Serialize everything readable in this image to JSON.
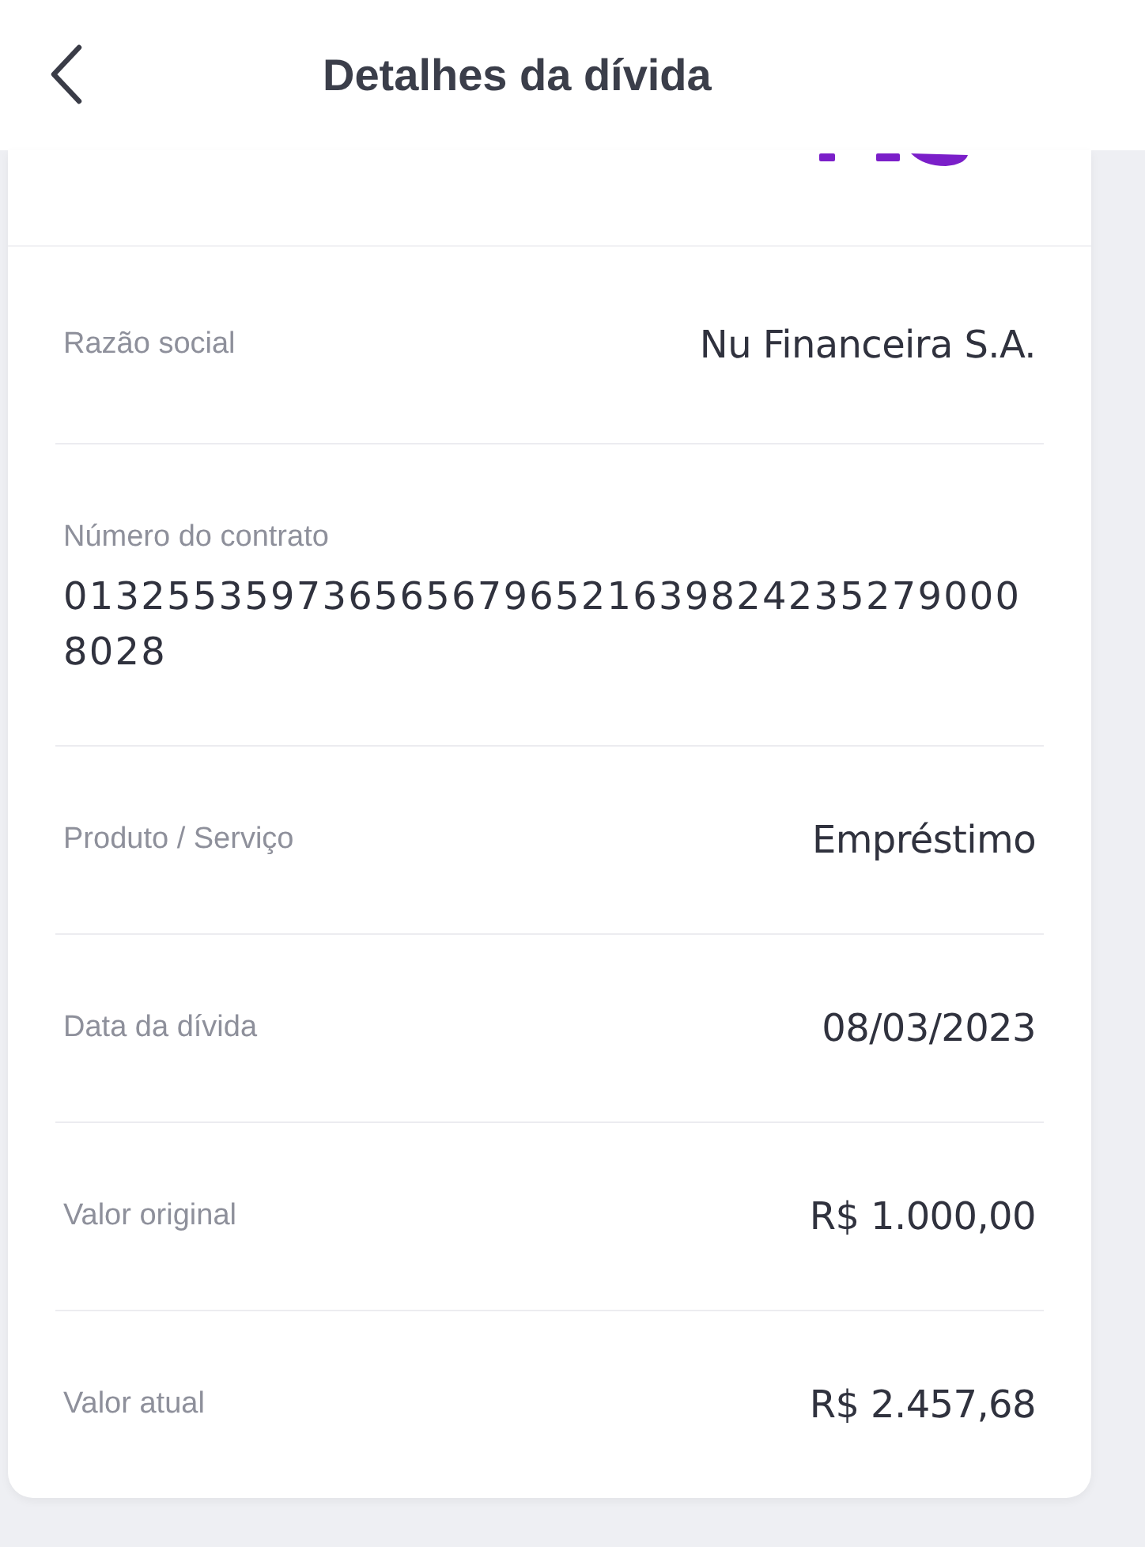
{
  "header": {
    "title": "Detalhes da dívida"
  },
  "details": [
    {
      "kind": "inline",
      "label": "Razão social",
      "value": "Nu Financeira S.A."
    },
    {
      "kind": "stacked",
      "label": "Número do contrato",
      "value": "01325535973656567965216398242352790008028"
    },
    {
      "kind": "inline",
      "label": "Produto / Serviço",
      "value": "Empréstimo"
    },
    {
      "kind": "inline",
      "label": "Data da dívida",
      "value": "08/03/2023"
    },
    {
      "kind": "inline",
      "label": "Valor original",
      "value": "R$ 1.000,00"
    },
    {
      "kind": "inline",
      "label": "Valor atual",
      "value": "R$ 2.457,68"
    }
  ]
}
